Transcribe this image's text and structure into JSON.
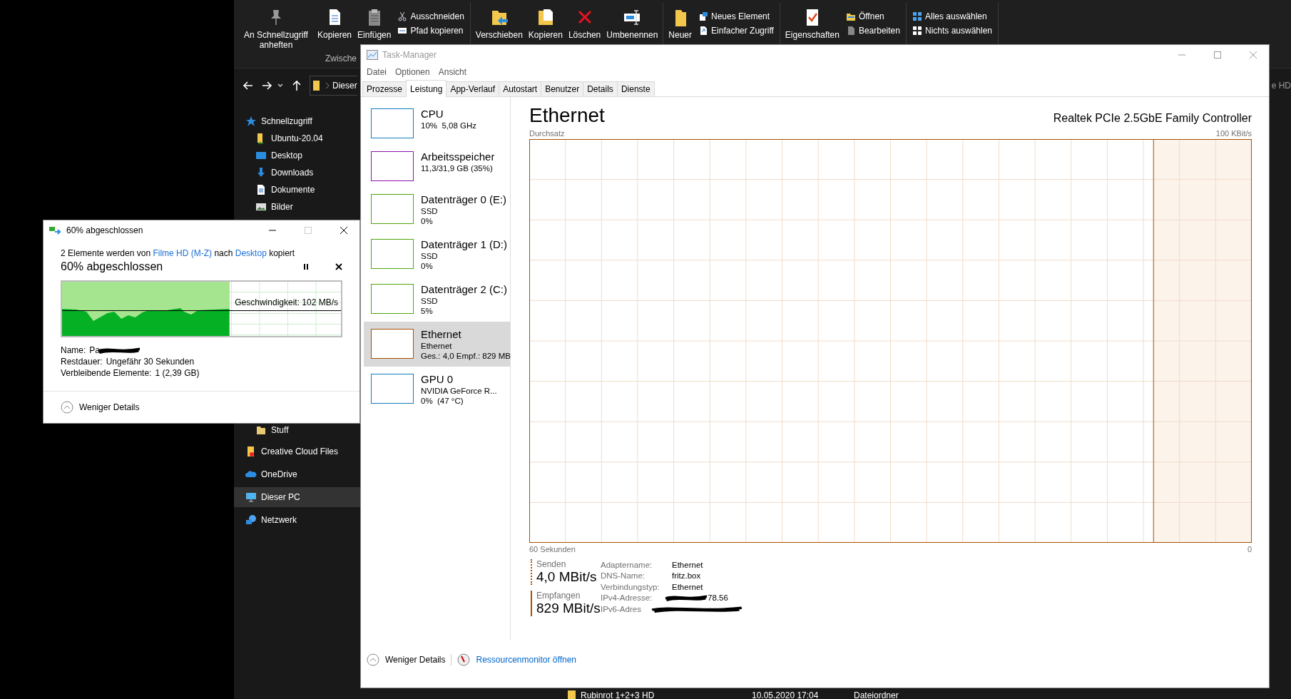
{
  "explorer": {
    "ribbon": {
      "groups": [
        {
          "label": "Zwische",
          "columns": [
            {
              "kind": "large",
              "label": "An Schnellzugriff anheften"
            },
            {
              "kind": "large",
              "label": "Kopieren"
            },
            {
              "kind": "large",
              "label": "Einfügen"
            },
            {
              "kind": "stack",
              "items": [
                "Ausschneiden",
                "Pfad kopieren"
              ]
            }
          ]
        },
        {
          "columns": [
            {
              "kind": "large",
              "label": "Verschieben"
            },
            {
              "kind": "large",
              "label": "Kopieren"
            },
            {
              "kind": "large",
              "label": "Löschen"
            },
            {
              "kind": "large",
              "label": "Umbenennen"
            }
          ]
        },
        {
          "columns": [
            {
              "kind": "large",
              "label": "Neuer"
            },
            {
              "kind": "stack",
              "items": [
                "Neues Element",
                "Einfacher Zugriff"
              ]
            }
          ]
        },
        {
          "columns": [
            {
              "kind": "large",
              "label": "Eigenschaften"
            },
            {
              "kind": "stack",
              "items": [
                "Öffnen",
                "Bearbeiten"
              ]
            }
          ]
        },
        {
          "columns": [
            {
              "kind": "stack",
              "items": [
                "Alles auswählen",
                "Nichts auswählen"
              ]
            }
          ]
        }
      ]
    },
    "address": "Dieser",
    "search_text": "e HD",
    "nav": [
      {
        "label": "Schnellzugriff",
        "selected": false,
        "children": [
          {
            "label": "Ubuntu-20.04",
            "selected": false
          },
          {
            "label": "Desktop",
            "selected": false
          },
          {
            "label": "Downloads",
            "selected": false
          },
          {
            "label": "Dokumente",
            "selected": false
          },
          {
            "label": "Bilder",
            "selected": false
          },
          {
            "label": "Stuff",
            "selected": false
          }
        ]
      },
      {
        "label": "Creative Cloud Files",
        "selected": false
      },
      {
        "label": "OneDrive",
        "selected": false
      },
      {
        "label": "Dieser PC",
        "selected": true
      },
      {
        "label": "Netzwerk",
        "selected": false
      }
    ],
    "file_row": {
      "name": "Rubinrot 1+2+3 HD",
      "date": "10.05.2020 17:04",
      "type": "Dateiordner"
    }
  },
  "task_manager": {
    "title": "Task-Manager",
    "menu": [
      "Datei",
      "Optionen",
      "Ansicht"
    ],
    "tabs": [
      {
        "label": "Prozesse",
        "selected": false
      },
      {
        "label": "Leistung",
        "selected": true
      },
      {
        "label": "App-Verlauf",
        "selected": false
      },
      {
        "label": "Autostart",
        "selected": false
      },
      {
        "label": "Benutzer",
        "selected": false
      },
      {
        "label": "Details",
        "selected": false
      },
      {
        "label": "Dienste",
        "selected": false
      }
    ],
    "resources": [
      {
        "name": "CPU",
        "lines": [
          "10%  5,08 GHz"
        ],
        "color": "#117dbb",
        "selected": false
      },
      {
        "name": "Arbeitsspeicher",
        "lines": [
          "11,3/31,9 GB (35%)"
        ],
        "color": "#8b12ae",
        "selected": false
      },
      {
        "name": "Datenträger 0 (E:)",
        "lines": [
          "SSD",
          "0%"
        ],
        "color": "#4da60c",
        "selected": false
      },
      {
        "name": "Datenträger 1 (D:)",
        "lines": [
          "SSD",
          "0%"
        ],
        "color": "#4da60c",
        "selected": false
      },
      {
        "name": "Datenträger 2 (C:)",
        "lines": [
          "SSD",
          "5%"
        ],
        "color": "#4da60c",
        "selected": false
      },
      {
        "name": "Ethernet",
        "lines": [
          "Ethernet",
          "Ges.: 4,0 Empf.: 829 MB"
        ],
        "color": "#a74f01",
        "selected": true
      },
      {
        "name": "GPU 0",
        "lines": [
          "NVIDIA GeForce R...",
          "0%  (47 °C)"
        ],
        "color": "#117dbb",
        "selected": false
      }
    ],
    "detail": {
      "title": "Ethernet",
      "adapter": "Realtek PCIe 2.5GbE Family Controller",
      "graph_label": "Durchsatz",
      "graph_max": "100 KBit/s",
      "time_span": "60 Sekunden",
      "time_end": "0",
      "send": {
        "label": "Senden",
        "value": "4,0 MBit/s"
      },
      "receive": {
        "label": "Empfangen",
        "value": "829 MBit/s"
      },
      "properties": [
        {
          "label": "Adaptername:",
          "value": "Ethernet"
        },
        {
          "label": "DNS-Name:",
          "value": "fritz.box"
        },
        {
          "label": "Verbindungstyp:",
          "value": "Ethernet"
        },
        {
          "label": "IPv4-Adresse:",
          "value": "78.56",
          "redacted": true
        },
        {
          "label": "IPv6-Adres",
          "redacted": true
        }
      ]
    },
    "footer": {
      "fewer_details": "Weniger Details",
      "monitor_link": "Ressourcenmonitor öffnen"
    }
  },
  "copy_dialog": {
    "title": "60% abgeschlossen",
    "description": {
      "before": "2 Elemente werden von ",
      "source": "Filme HD (M-Z)",
      "middle": " nach ",
      "destination": "Desktop",
      "after": " kopiert"
    },
    "heading": "60% abgeschlossen",
    "progress": {
      "level": 0.6,
      "speed": "Geschwindigkeit: 102 MB/s"
    },
    "details": [
      {
        "label": "Name:",
        "value": "Pa",
        "redacted": true
      },
      {
        "label": "Restdauer:",
        "value": "Ungefähr 30 Sekunden"
      },
      {
        "label": "Verbleibende Elemente:",
        "value": "1 (2,39 GB)"
      }
    ],
    "fewer_details": "Weniger Details"
  }
}
